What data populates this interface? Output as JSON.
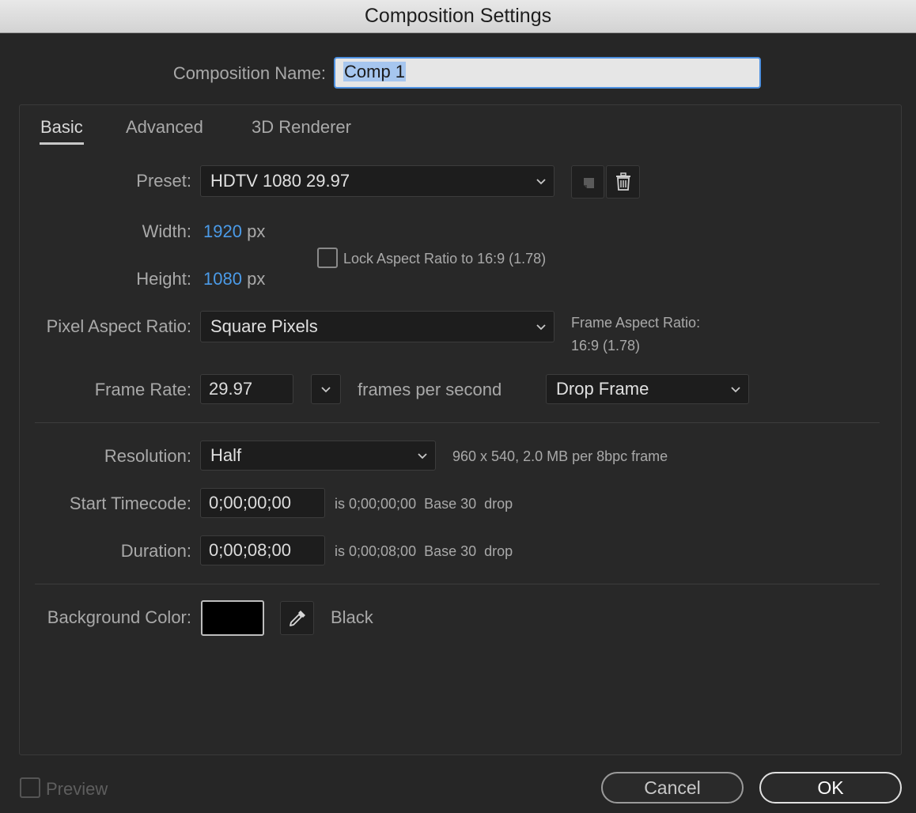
{
  "window": {
    "title": "Composition Settings"
  },
  "composition_name": {
    "label": "Composition Name:",
    "value": "Comp 1"
  },
  "tabs": [
    {
      "label": "Basic",
      "active": true
    },
    {
      "label": "Advanced",
      "active": false
    },
    {
      "label": "3D Renderer",
      "active": false
    }
  ],
  "preset": {
    "label": "Preset:",
    "value": "HDTV 1080 29.97"
  },
  "width": {
    "label": "Width:",
    "value": "1920",
    "unit": "px"
  },
  "height": {
    "label": "Height:",
    "value": "1080",
    "unit": "px"
  },
  "lock_aspect": {
    "label": "Lock Aspect Ratio to 16:9 (1.78)",
    "checked": false
  },
  "pixel_aspect_ratio": {
    "label": "Pixel Aspect Ratio:",
    "value": "Square Pixels"
  },
  "frame_aspect_ratio": {
    "label": "Frame Aspect Ratio:",
    "value": "16:9 (1.78)"
  },
  "frame_rate": {
    "label": "Frame Rate:",
    "value": "29.97",
    "unit_label": "frames per second",
    "drop_frame": "Drop Frame"
  },
  "resolution": {
    "label": "Resolution:",
    "value": "Half",
    "info": "960 x 540, 2.0 MB per 8bpc frame"
  },
  "start_timecode": {
    "label": "Start Timecode:",
    "value": "0;00;00;00",
    "info": "is 0;00;00;00  Base 30  drop"
  },
  "duration": {
    "label": "Duration:",
    "value": "0;00;08;00",
    "info": "is 0;00;08;00  Base 30  drop"
  },
  "background_color": {
    "label": "Background Color:",
    "color": "#000000",
    "name": "Black"
  },
  "footer": {
    "preview_label": "Preview",
    "preview_checked": false,
    "cancel_label": "Cancel",
    "ok_label": "OK"
  },
  "icons": {
    "preset_save": "save-preset-icon",
    "preset_delete": "trash-icon",
    "eyedropper": "eyedropper-icon",
    "chevron": "chevron-down-icon"
  },
  "colors": {
    "accent": "#4b9be8",
    "background": "#262626",
    "field": "#1d1d1d"
  }
}
